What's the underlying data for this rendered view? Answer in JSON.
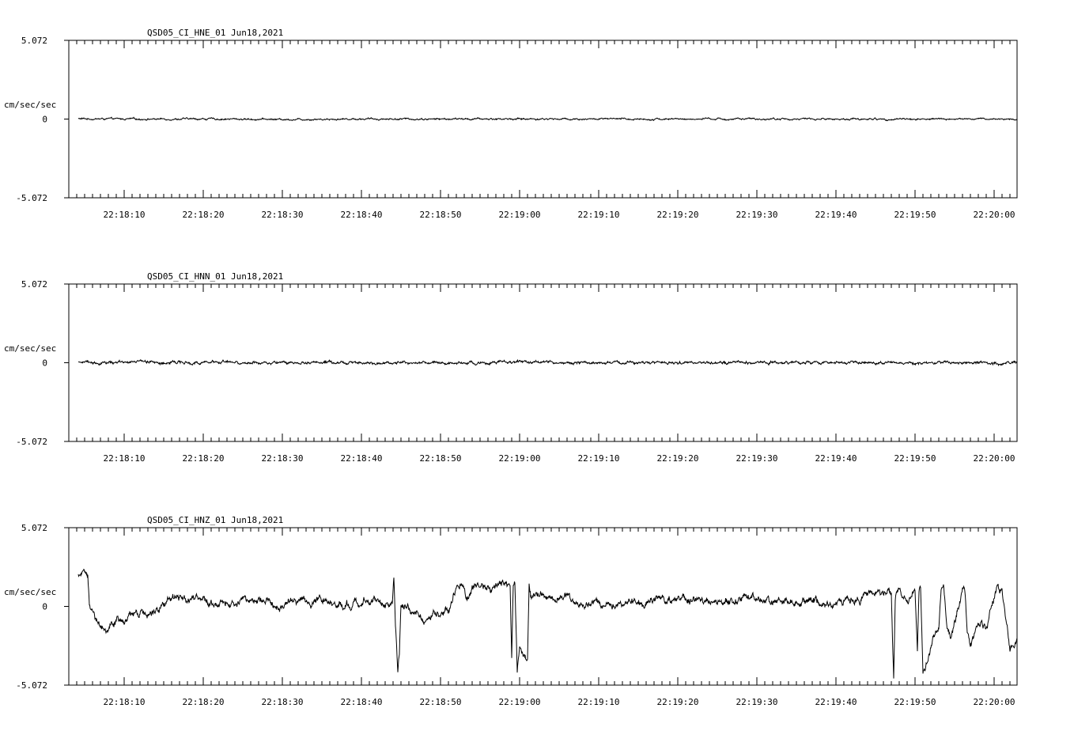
{
  "chart_data": [
    {
      "type": "line",
      "title": "QSD05_CI_HNE_01  Jun18,2021",
      "ylabel": "cm/sec/sec",
      "ylim": [
        -5.072,
        5.072
      ],
      "y_tick_labels": [
        "5.072",
        "0",
        "-5.072"
      ],
      "x_tick_labels": [
        "22:18:10",
        "22:18:20",
        "22:18:30",
        "22:18:40",
        "22:18:50",
        "22:19:00",
        "22:19:10",
        "22:19:20",
        "22:19:30",
        "22:19:40",
        "22:19:50",
        "22:20:00"
      ],
      "x_range_seconds": [
        3.0,
        122.9
      ],
      "series": [
        {
          "x": [
            4.2,
            10,
            20,
            30,
            40,
            50,
            60,
            70,
            80,
            90,
            100,
            110,
            122.9
          ],
          "y": [
            0.02,
            0.0,
            0.01,
            -0.02,
            0.01,
            0.0,
            0.01,
            0.0,
            0.0,
            0.0,
            0.0,
            0.0,
            0.0
          ]
        }
      ],
      "noise_amplitude": 0.06
    },
    {
      "type": "line",
      "title": "QSD05_CI_HNN_01  Jun18,2021",
      "ylabel": "cm/sec/sec",
      "ylim": [
        -5.072,
        5.072
      ],
      "y_tick_labels": [
        "5.072",
        "0",
        "-5.072"
      ],
      "x_tick_labels": [
        "22:18:10",
        "22:18:20",
        "22:18:30",
        "22:18:40",
        "22:18:50",
        "22:19:00",
        "22:19:10",
        "22:19:20",
        "22:19:30",
        "22:19:40",
        "22:19:50",
        "22:20:00"
      ],
      "x_range_seconds": [
        3.0,
        122.9
      ],
      "series": [
        {
          "x": [
            4.2,
            10,
            20,
            30,
            38,
            50,
            60,
            70,
            80,
            90,
            100,
            110,
            122.9
          ],
          "y": [
            0.05,
            0.02,
            0.04,
            0.01,
            0.02,
            0.0,
            0.0,
            0.0,
            0.0,
            0.0,
            0.0,
            0.0,
            0.0
          ]
        }
      ],
      "noise_amplitude": 0.1
    },
    {
      "type": "line",
      "title": "QSD05_CI_HNZ_01  Jun18,2021",
      "ylabel": "cm/sec/sec",
      "ylim": [
        -5.072,
        5.072
      ],
      "y_tick_labels": [
        "5.072",
        "0",
        "-5.072"
      ],
      "x_tick_labels": [
        "22:18:10",
        "22:18:20",
        "22:18:30",
        "22:18:40",
        "22:18:50",
        "22:19:00",
        "22:19:10",
        "22:19:20",
        "22:19:30",
        "22:19:40",
        "22:19:50",
        "22:20:00"
      ],
      "x_range_seconds": [
        3.0,
        122.9
      ],
      "series": [
        {
          "x": [
            4.2,
            5.4,
            5.6,
            6.5,
            8.0,
            8.5,
            10.0,
            12.0,
            14.0,
            16.0,
            18.0,
            20.0,
            22.0,
            24.0,
            26.0,
            28.0,
            30.0,
            32.0,
            34.0,
            36.0,
            38.0,
            40.0,
            42.0,
            43.9,
            44.1,
            44.3,
            44.6,
            44.8,
            45.0,
            46.0,
            47.0,
            48.0,
            49.0,
            50.0,
            51.0,
            52.0,
            53.0,
            53.2,
            54.0,
            55.0,
            56.0,
            57.0,
            58.0,
            58.8,
            59.0,
            59.2,
            59.4,
            59.7,
            60.0,
            61.0,
            61.2,
            61.4,
            61.6,
            62.0,
            63.0,
            66.0,
            67.0,
            70.0,
            75.0,
            80.0,
            85.0,
            90.0,
            95.0,
            100.0,
            103.0,
            104.0,
            107.0,
            107.3,
            107.5,
            108.0,
            109.0,
            110.0,
            110.3,
            110.5,
            110.7,
            111.0,
            112.0,
            113.0,
            113.3,
            113.6,
            114.0,
            114.5,
            115.0,
            116.0,
            116.3,
            116.6,
            117.0,
            118.0,
            119.0,
            120.0,
            120.3,
            120.5,
            121.0,
            122.0,
            122.9
          ],
          "y": [
            2.05,
            1.95,
            0.3,
            -0.8,
            -1.8,
            -1.2,
            -0.8,
            -0.6,
            -0.2,
            0.5,
            0.6,
            0.4,
            0.0,
            0.3,
            0.5,
            0.3,
            0.2,
            0.3,
            0.4,
            0.3,
            0.2,
            0.2,
            0.4,
            0.2,
            2.0,
            -1.0,
            -4.2,
            -3.0,
            0.1,
            0.0,
            -0.3,
            -0.9,
            -0.4,
            -0.3,
            -0.2,
            1.1,
            1.3,
            0.7,
            1.2,
            1.3,
            1.2,
            1.2,
            1.6,
            1.5,
            -3.3,
            1.5,
            1.6,
            -4.2,
            -2.8,
            -3.3,
            1.6,
            0.8,
            0.7,
            0.8,
            0.7,
            0.6,
            0.1,
            0.1,
            0.3,
            0.4,
            0.4,
            0.4,
            0.3,
            0.2,
            0.5,
            1.0,
            0.8,
            -4.5,
            0.9,
            1.1,
            0.5,
            0.9,
            -3.0,
            0.8,
            1.0,
            -4.5,
            -2.5,
            -1.5,
            1.1,
            1.2,
            -1.5,
            -2.0,
            -1.0,
            1.2,
            1.1,
            -1.5,
            -2.5,
            -1.0,
            -1.5,
            0.5,
            1.1,
            1.0,
            1.0,
            -3.0,
            -2.0
          ]
        }
      ],
      "noise_amplitude": 0.28
    }
  ]
}
